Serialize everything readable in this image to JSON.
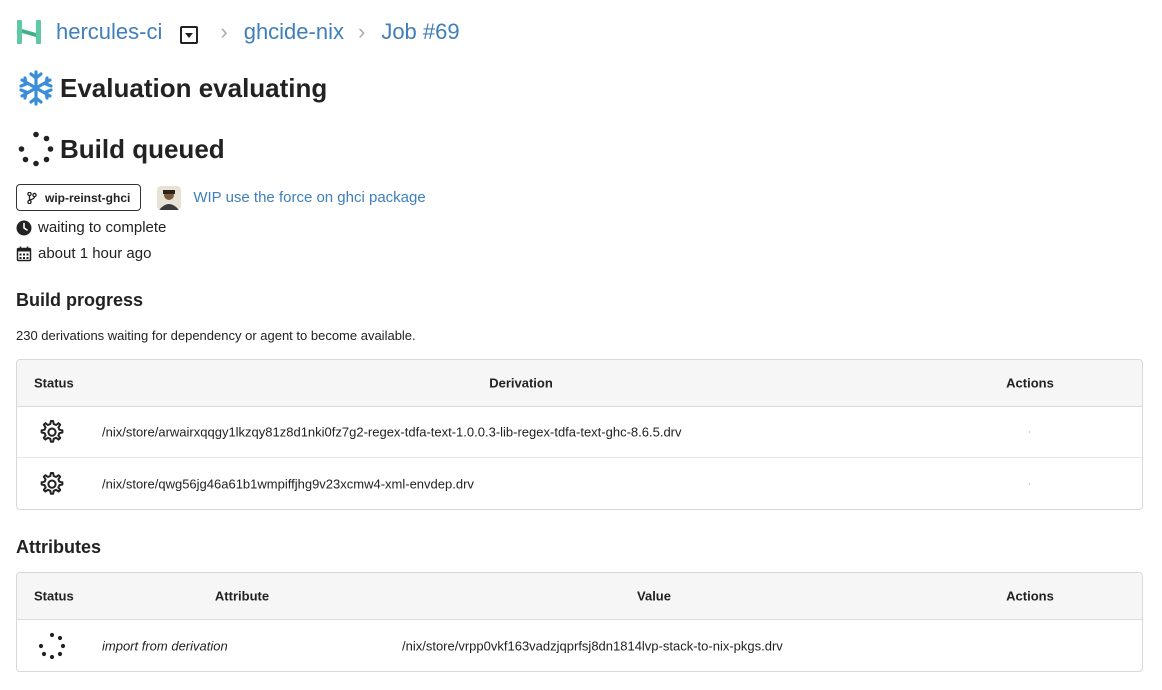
{
  "breadcrumb": {
    "org": "hercules-ci",
    "repo": "ghcide-nix",
    "job": "Job #69",
    "separator": "›"
  },
  "evaluation": {
    "title": "Evaluation evaluating",
    "icon": "snowflake-icon"
  },
  "build": {
    "title": "Build queued",
    "icon": "spinner-icon"
  },
  "commit": {
    "branch": "wip-reinst-ghci",
    "message": "WIP use the force on ghci package",
    "status": "waiting to complete",
    "time": "about 1 hour ago"
  },
  "build_progress": {
    "title": "Build progress",
    "summary": "230 derivations waiting for dependency or agent to become available.",
    "columns": {
      "status": "Status",
      "derivation": "Derivation",
      "actions": "Actions"
    },
    "rows": [
      {
        "status_icon": "gear-icon",
        "derivation": "/nix/store/arwairxqqgy1lkzqy81z8d1nki0fz7g2-regex-tdfa-text-1.0.0.3-lib-regex-tdfa-text-ghc-8.6.5.drv"
      },
      {
        "status_icon": "gear-icon",
        "derivation": "/nix/store/qwg56jg46a61b1wmpiffjhg9v23xcmw4-xml-envdep.drv"
      }
    ]
  },
  "attributes": {
    "title": "Attributes",
    "columns": {
      "status": "Status",
      "attribute": "Attribute",
      "value": "Value",
      "actions": "Actions"
    },
    "rows": [
      {
        "status_icon": "spinner-icon",
        "attribute": "import from derivation",
        "value": "/nix/store/vrpp0vkf163vadzjqprfsj8dn1814lvp-stack-to-nix-pkgs.drv"
      }
    ]
  },
  "colors": {
    "link": "#3f7fba",
    "logo": "#5fc9a3",
    "snowflake": "#3a8ed8"
  }
}
